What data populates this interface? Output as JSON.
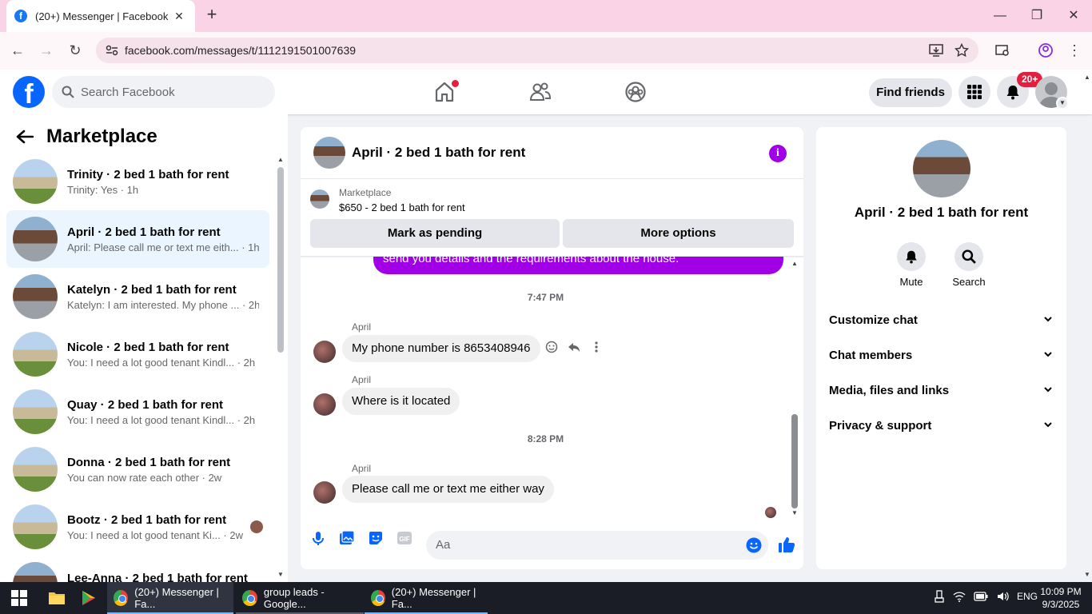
{
  "browser": {
    "tab_title": "(20+) Messenger | Facebook",
    "url": "facebook.com/messages/t/1112191501007639"
  },
  "fb": {
    "search_placeholder": "Search Facebook",
    "find_friends": "Find friends",
    "notif_badge": "20+"
  },
  "sidebar": {
    "title": "Marketplace",
    "conversations": [
      {
        "name": "Trinity · 2 bed 1 bath for rent",
        "snippet": "Trinity: Yes · 1h"
      },
      {
        "name": "April · 2 bed 1 bath for rent",
        "snippet": "April: Please call me or text me eith... · 1h"
      },
      {
        "name": "Katelyn · 2 bed 1 bath for rent",
        "snippet": "Katelyn: I am interested. My phone ... · 2h"
      },
      {
        "name": "Nicole · 2 bed 1 bath for rent",
        "snippet": "You: I need a lot good tenant Kindl... · 2h"
      },
      {
        "name": "Quay · 2 bed 1 bath for rent",
        "snippet": "You: I need a lot good tenant Kindl... · 2h"
      },
      {
        "name": "Donna · 2 bed 1 bath for rent",
        "snippet": "You can now rate each other · 2w"
      },
      {
        "name": "Bootz · 2 bed 1 bath for rent",
        "snippet": "You: I need a lot good tenant Ki... · 2w"
      },
      {
        "name": "Lee-Anna · 2 bed 1 bath for rent",
        "snippet": ""
      }
    ]
  },
  "chat": {
    "title": "April · 2 bed 1 bath for rent",
    "marketplace_label": "Marketplace",
    "listing": "$650 - 2 bed 1 bath for rent",
    "mark_pending": "Mark as pending",
    "more_options": "More options",
    "outgoing_partial": "send you details and the requirements about the house.",
    "time1": "7:47 PM",
    "time2": "8:28 PM",
    "sender": "April",
    "messages": [
      "My phone number is 8653408946",
      "Where is it located",
      "Please call me or text me either way"
    ],
    "composer_placeholder": "Aa"
  },
  "details": {
    "title": "April · 2 bed 1 bath for rent",
    "mute": "Mute",
    "search": "Search",
    "sections": [
      "Customize chat",
      "Chat members",
      "Media, files and links",
      "Privacy & support"
    ]
  },
  "taskbar": {
    "apps": [
      "(20+) Messenger | Fa...",
      "group leads - Google...",
      "(20+) Messenger | Fa..."
    ],
    "lang": "ENG",
    "time": "10:09 PM",
    "date": "9/3/2025"
  },
  "colors": {
    "fb_blue": "#0866ff",
    "accent_purple": "#a100e6",
    "active_row": "#ebf5ff"
  }
}
